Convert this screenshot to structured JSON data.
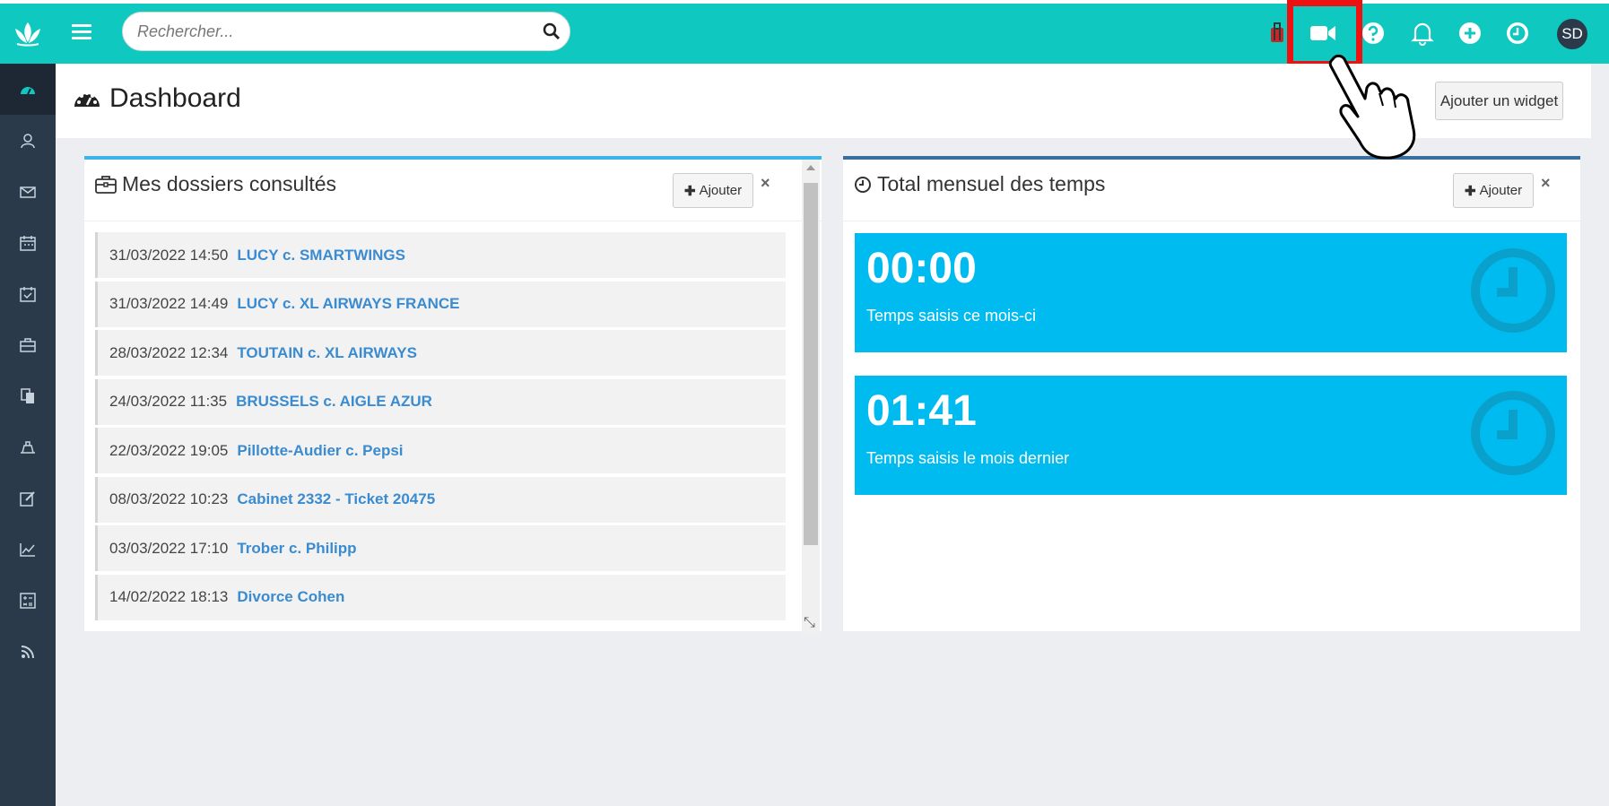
{
  "app": {
    "search_placeholder": "Rechercher...",
    "avatar_initials": "SD",
    "accent_color": "#0fc8bf",
    "sidebar_color": "#2b3a4a"
  },
  "sidebar": {
    "items": [
      {
        "icon": "dashboard-icon",
        "active": true
      },
      {
        "icon": "contacts-icon"
      },
      {
        "icon": "mail-icon"
      },
      {
        "icon": "calendar-icon"
      },
      {
        "icon": "tasks-icon"
      },
      {
        "icon": "briefcase-icon"
      },
      {
        "icon": "documents-icon"
      },
      {
        "icon": "billing-icon"
      },
      {
        "icon": "edit-icon"
      },
      {
        "icon": "chart-icon"
      },
      {
        "icon": "calculator-icon"
      },
      {
        "icon": "rss-icon"
      }
    ]
  },
  "topbar": {
    "icons": [
      "luggage-icon",
      "video-icon",
      "help-icon",
      "bell-icon",
      "add-icon",
      "clock-icon"
    ]
  },
  "page": {
    "title": "Dashboard",
    "add_widget_label": "Ajouter un widget"
  },
  "widgets": {
    "dossiers": {
      "title": "Mes dossiers consultés",
      "add_label": "Ajouter",
      "close_label": "×",
      "rows": [
        {
          "date": "31/03/2022 14:50",
          "name": "LUCY c. SMARTWINGS"
        },
        {
          "date": "31/03/2022 14:49",
          "name": "LUCY c. XL AIRWAYS FRANCE"
        },
        {
          "date": "28/03/2022 12:34",
          "name": "TOUTAIN c. XL AIRWAYS"
        },
        {
          "date": "24/03/2022 11:35",
          "name": "BRUSSELS c. AIGLE AZUR"
        },
        {
          "date": "22/03/2022 19:05",
          "name": "Pillotte-Audier c. Pepsi"
        },
        {
          "date": "08/03/2022 10:23",
          "name": "Cabinet 2332 - Ticket 20475"
        },
        {
          "date": "03/03/2022 17:10",
          "name": "Trober c. Philipp"
        },
        {
          "date": "14/02/2022 18:13",
          "name": "Divorce Cohen"
        }
      ]
    },
    "temps": {
      "title": "Total mensuel des temps",
      "add_label": "Ajouter",
      "close_label": "×",
      "tiles": [
        {
          "value": "00:00",
          "label": "Temps saisis ce mois-ci"
        },
        {
          "value": "01:41",
          "label": "Temps saisis le mois dernier"
        }
      ]
    }
  }
}
